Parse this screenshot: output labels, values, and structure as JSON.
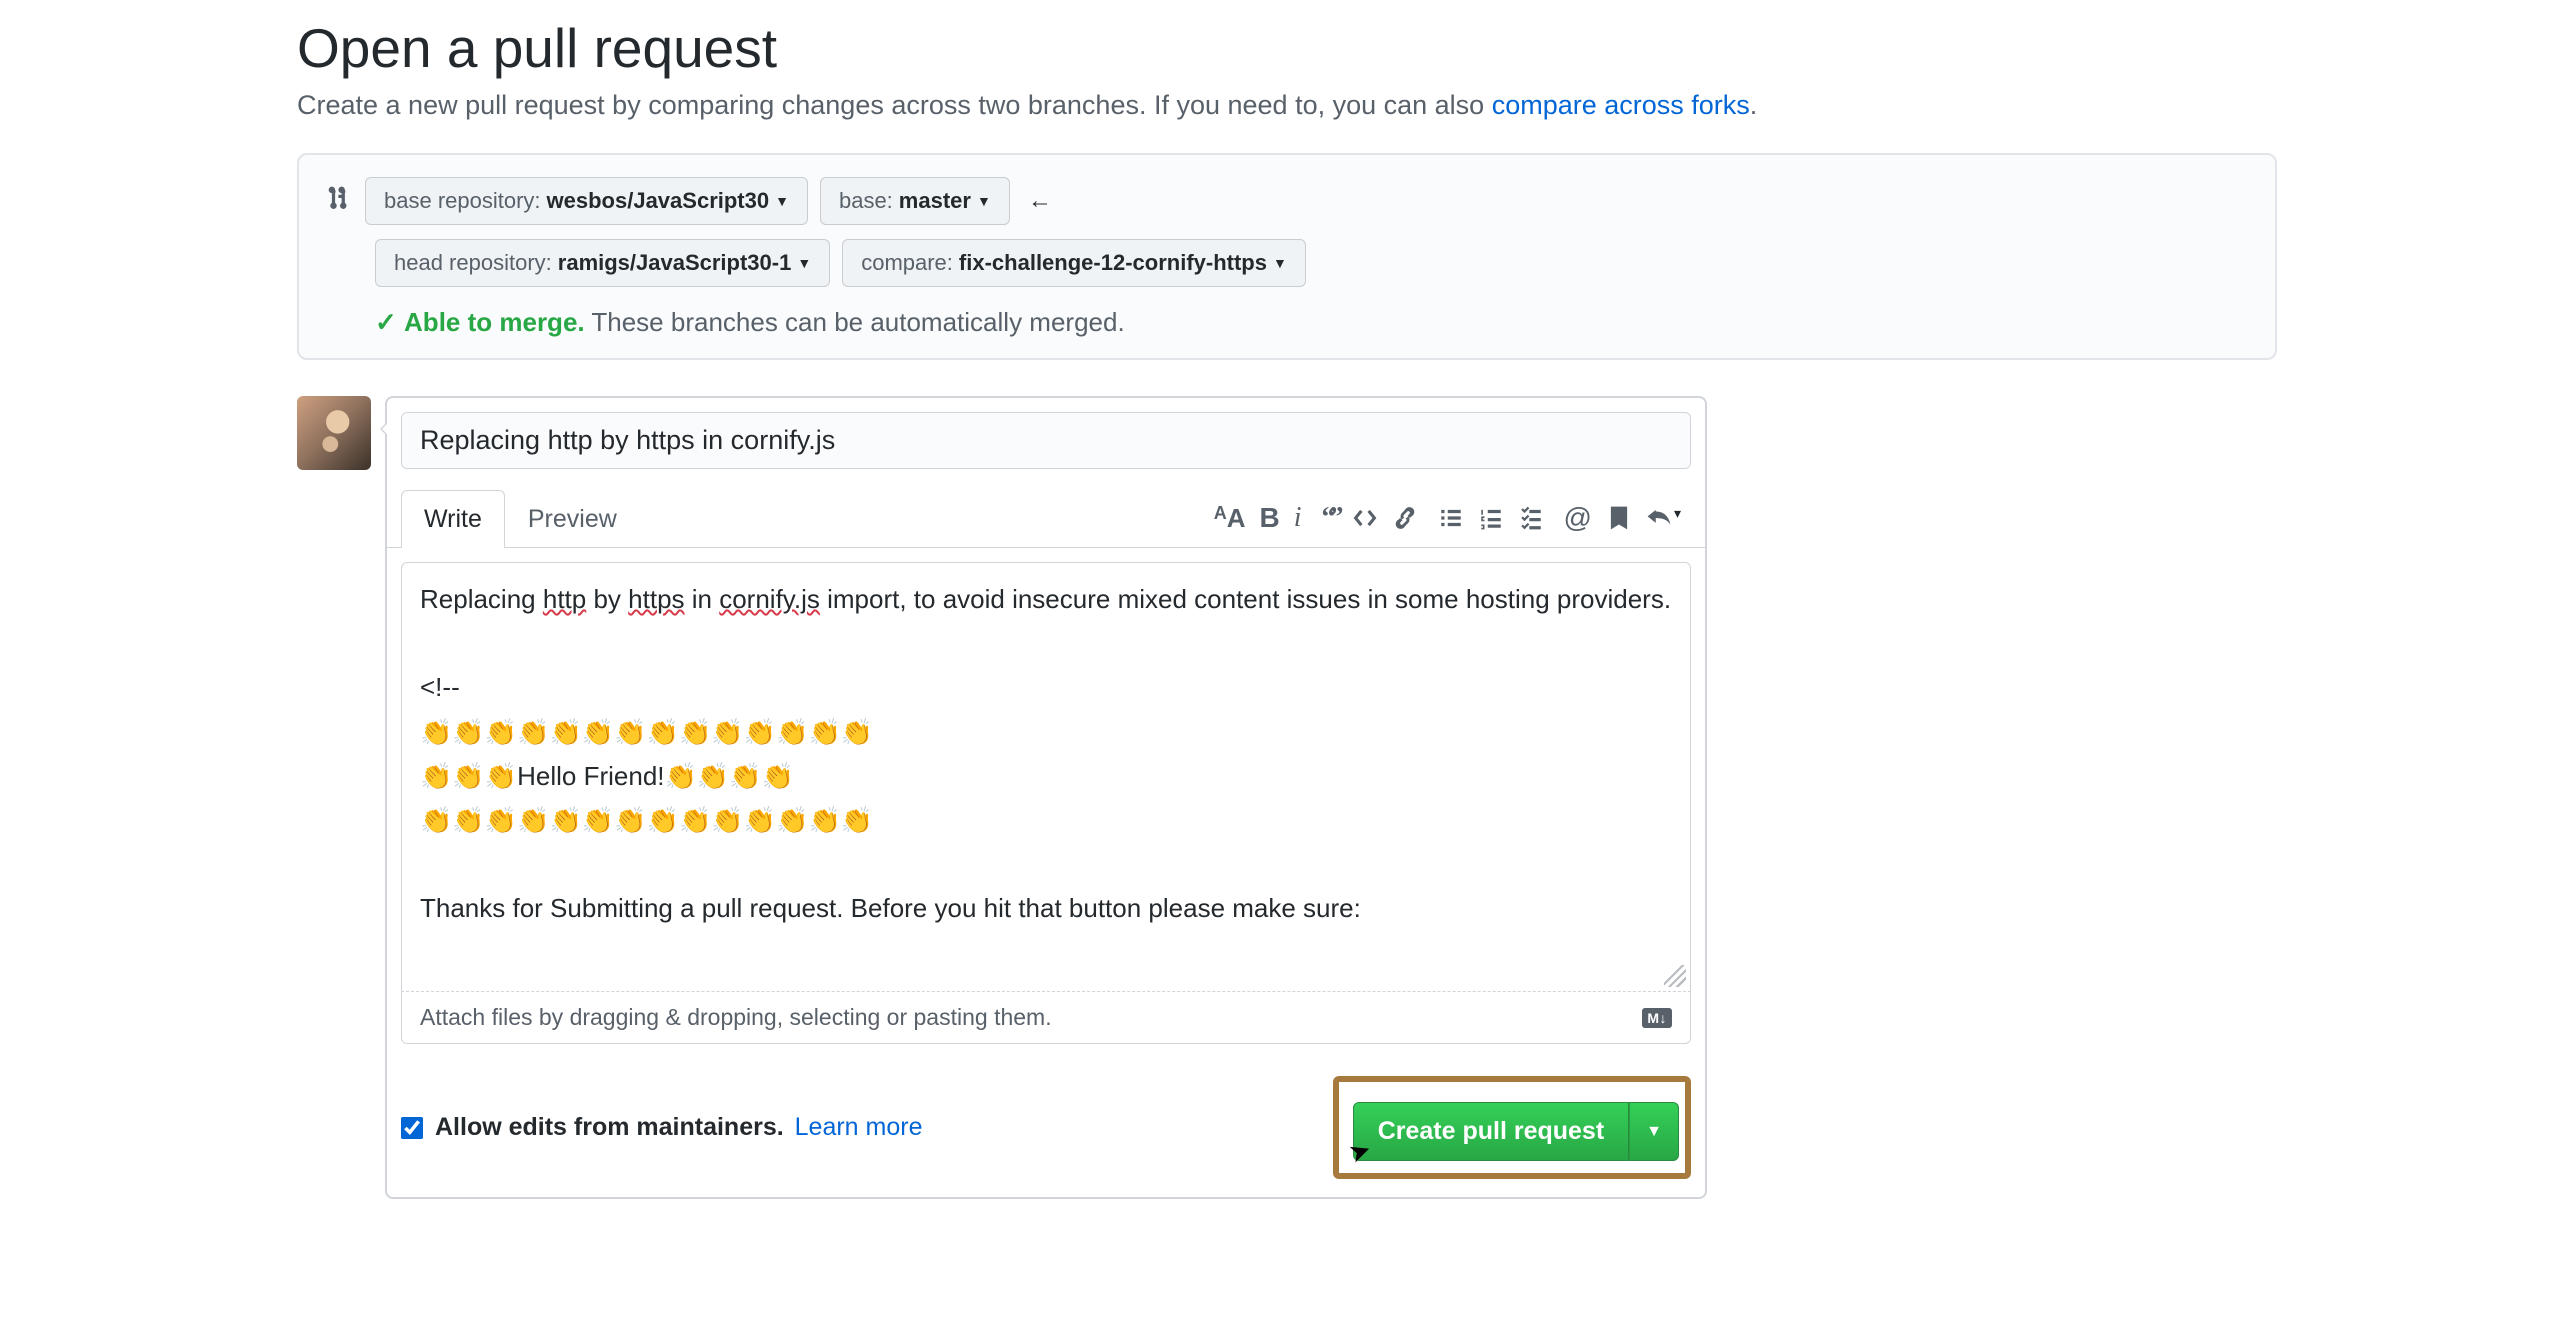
{
  "header": {
    "title": "Open a pull request",
    "subtitle_pre": "Create a new pull request by comparing changes across two branches. If you need to, you can also ",
    "subtitle_link": "compare across forks",
    "subtitle_post": "."
  },
  "compare": {
    "base_repo_label": "base repository: ",
    "base_repo_value": "wesbos/JavaScript30",
    "base_branch_label": "base: ",
    "base_branch_value": "master",
    "head_repo_label": "head repository: ",
    "head_repo_value": "ramigs/JavaScript30-1",
    "compare_label": "compare: ",
    "compare_value": "fix-challenge-12-cornify-https",
    "merge_able": "Able to merge.",
    "merge_msg": " These branches can be automatically merged."
  },
  "pr": {
    "title": "Replacing http by https in cornify.js",
    "tabs": {
      "write": "Write",
      "preview": "Preview"
    },
    "body_line1_a": "Replacing ",
    "body_line1_b": " by ",
    "body_line1_c": " in ",
    "body_line1_d": " import, to avoid insecure mixed content issues in some hosting providers.",
    "sp_http": "http",
    "sp_https": "https",
    "sp_cornify": "cornify.js",
    "body_line2": "<!--",
    "body_line3": "👏👏👏👏👏👏👏👏👏👏👏👏👏👏",
    "body_line4": "👏👏👏Hello Friend!👏👏👏👏",
    "body_line5": "👏👏👏👏👏👏👏👏👏👏👏👏👏👏",
    "body_line6": "Thanks for Submitting a pull request. Before you hit that button please make sure:",
    "attach_hint": "Attach files by dragging & dropping, selecting or pasting them.",
    "md_badge": "M↓",
    "allow_edits": "Allow edits from maintainers.",
    "learn_more": "Learn more",
    "create_btn": "Create pull request"
  }
}
